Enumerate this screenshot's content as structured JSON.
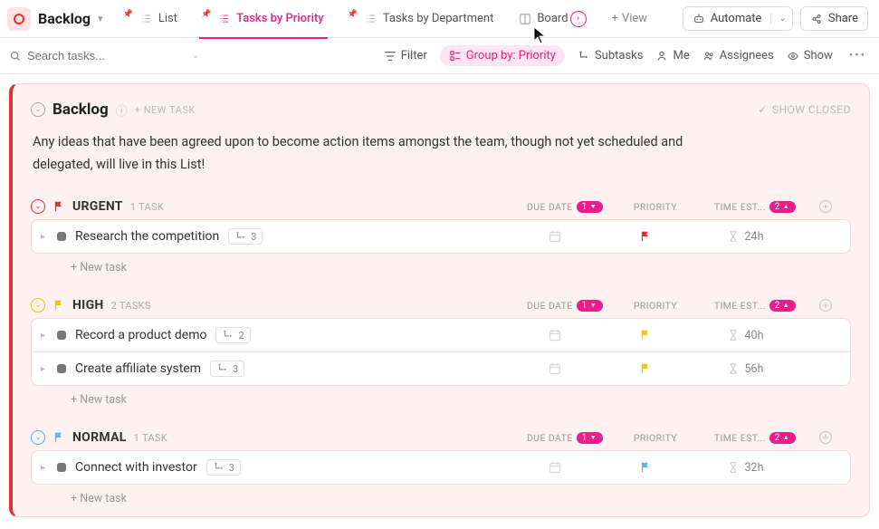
{
  "breadcrumb": {
    "title": "Backlog"
  },
  "views": {
    "list": "List",
    "by_priority": "Tasks by Priority",
    "by_department": "Tasks by Department",
    "board": "Board",
    "add": "View"
  },
  "top_buttons": {
    "automate": "Automate",
    "share": "Share"
  },
  "filterbar": {
    "search_placeholder": "Search tasks...",
    "filter": "Filter",
    "group_by": "Group by: Priority",
    "subtasks": "Subtasks",
    "me": "Me",
    "assignees": "Assignees",
    "show": "Show"
  },
  "list": {
    "title": "Backlog",
    "new_task": "+ NEW TASK",
    "show_closed": "SHOW CLOSED",
    "description": "Any ideas that have been agreed upon to become action items amongst the team, though not yet scheduled and delegated, will live in this List!"
  },
  "columns": {
    "due_date": "DUE DATE",
    "priority": "PRIORITY",
    "time_est": "TIME EST...",
    "due_badge": "1",
    "est_badge": "2"
  },
  "new_task_link": "+ New task",
  "groups": [
    {
      "name": "URGENT",
      "count_label": "1 TASK",
      "color": "red",
      "tasks": [
        {
          "name": "Research the competition",
          "subtasks": "3",
          "prio": "red",
          "est": "24h"
        }
      ]
    },
    {
      "name": "HIGH",
      "count_label": "2 TASKS",
      "color": "yellow",
      "tasks": [
        {
          "name": "Record a product demo",
          "subtasks": "2",
          "prio": "yellow",
          "est": "40h"
        },
        {
          "name": "Create affiliate system",
          "subtasks": "3",
          "prio": "yellow",
          "est": "56h"
        }
      ]
    },
    {
      "name": "NORMAL",
      "count_label": "1 TASK",
      "color": "cyan",
      "tasks": [
        {
          "name": "Connect with investor",
          "subtasks": "3",
          "prio": "cyan",
          "est": "32h"
        }
      ]
    }
  ]
}
